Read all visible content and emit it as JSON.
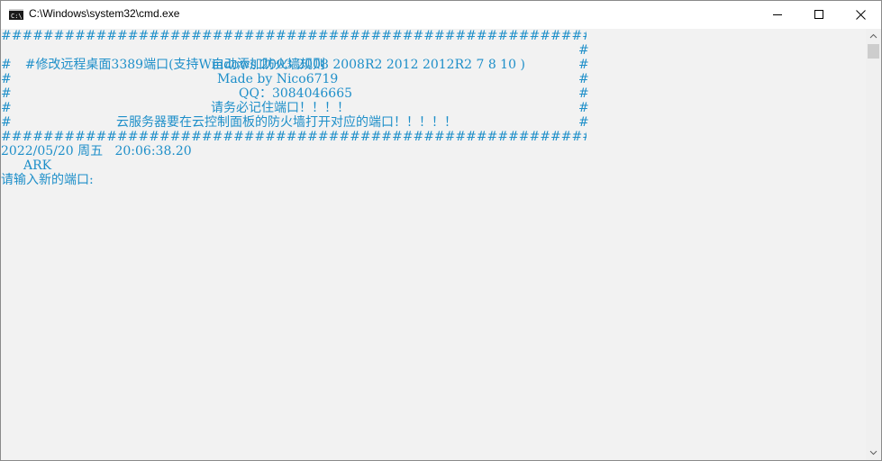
{
  "window": {
    "title": "C:\\Windows\\system32\\cmd.exe"
  },
  "caption_buttons": {
    "minimize_icon": "minimize-icon",
    "maximize_icon": "maximize-icon",
    "close_icon": "close-icon"
  },
  "console": {
    "text_color": "#1e8fc9",
    "background": "#f2f2f2",
    "border_char": "#",
    "border_row": "################################################################################",
    "banner": [
      "修改远程桌面3389端口(支持Windows 2003 2008 2008R2 2012 2012R2 7 8 10 )",
      "自动添加防火墙规则",
      "Made by Nico6719",
      "QQ：3084046665",
      "请务必记住端口！！！！",
      "云服务器要在云控制面板的防火墙打开对应的端口！！！！！"
    ],
    "datetime": "2022/05/20 周五   20:06:38.20",
    "hostname": "ARK",
    "prompt": "请输入新的端口:"
  }
}
